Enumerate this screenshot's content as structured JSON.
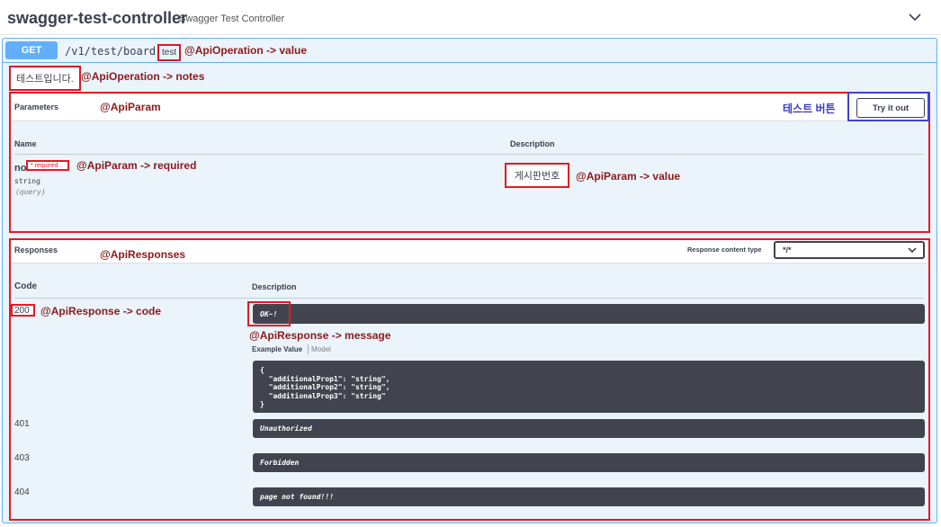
{
  "tag": {
    "name": "swagger-test-controller",
    "description": "Swagger Test Controller"
  },
  "operation": {
    "method": "GET",
    "path": "/v1/test/board",
    "summary": "test",
    "notes": "테스트입니다."
  },
  "annotations": {
    "op_value": "@ApiOperation -> value",
    "op_notes": "@ApiOperation -> notes",
    "api_param": "@ApiParam",
    "test_button": "테스트 버튼",
    "param_required": "@ApiParam -> required",
    "param_value": "@ApiParam -> value",
    "api_responses": "@ApiResponses",
    "response_code": "@ApiResponse -> code",
    "response_message": "@ApiResponse -> message"
  },
  "parameters": {
    "title": "Parameters",
    "try_button": "Try it out",
    "col_name": "Name",
    "col_description": "Description",
    "items": [
      {
        "name": "no",
        "required": "* required",
        "type": "string",
        "in": "(query)",
        "description": "게시판번호"
      }
    ]
  },
  "responses": {
    "title": "Responses",
    "content_type_label": "Response content type",
    "content_type_value": "*/*",
    "col_code": "Code",
    "col_description": "Description",
    "example_tab": "Example Value",
    "model_tab": "Model",
    "example_code": "{\n  \"additionalProp1\": \"string\",\n  \"additionalProp2\": \"string\",\n  \"additionalProp3\": \"string\"\n}",
    "items": [
      {
        "code": "200",
        "message": "OK~!"
      },
      {
        "code": "401",
        "message": "Unauthorized"
      },
      {
        "code": "403",
        "message": "Forbidden"
      },
      {
        "code": "404",
        "message": "page not found!!!"
      }
    ]
  },
  "colors": {
    "method_get": "#61affe",
    "annotation_red": "#8b1a1a",
    "annotation_blue": "#3b3cc4",
    "highlight_box": "#e31b23",
    "dark_block": "#41444e"
  },
  "icons": {
    "collapse": "chevron-down-icon",
    "select": "chevron-down-icon"
  }
}
